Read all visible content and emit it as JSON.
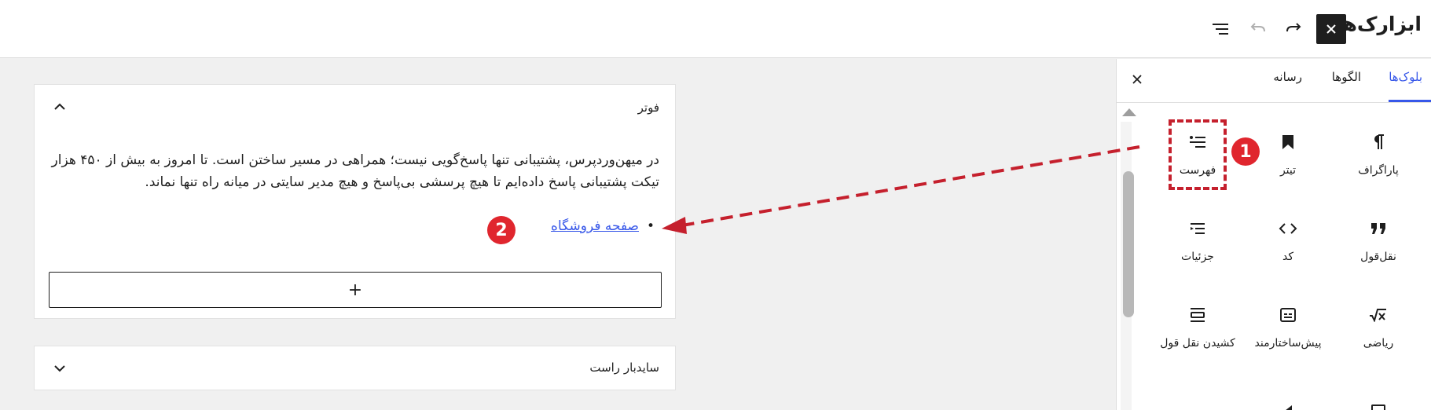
{
  "header": {
    "title": "ابزارک‌ها",
    "icons": [
      "close-icon",
      "redo-icon",
      "undo-icon",
      "list-view-icon"
    ]
  },
  "inserter": {
    "tabs": [
      {
        "label": "بلوک‌ها",
        "active": true
      },
      {
        "label": "الگوها",
        "active": false
      },
      {
        "label": "رسانه",
        "active": false
      }
    ],
    "blocks": [
      {
        "label": "پاراگراف",
        "icon": "paragraph-icon"
      },
      {
        "label": "تیتر",
        "icon": "heading-icon"
      },
      {
        "label": "فهرست",
        "icon": "list-icon"
      },
      {
        "label": "نقل‌قول",
        "icon": "quote-icon"
      },
      {
        "label": "کد",
        "icon": "code-icon"
      },
      {
        "label": "جزئیات",
        "icon": "details-icon"
      },
      {
        "label": "ریاضی",
        "icon": "math-icon"
      },
      {
        "label": "پیش‌ساختارمند",
        "icon": "preformatted-icon"
      },
      {
        "label": "کشیدن نقل قول",
        "icon": "pullquote-icon"
      }
    ]
  },
  "editor": {
    "footer_area": {
      "title": "فوتر",
      "paragraph": "در میهن‌وردپرس، پشتیبانی تنها پاسخ‌گویی نیست؛ همراهی در مسیر ساختن است. تا امروز به بیش از ۴۵۰ هزار تیکت پشتیبانی پاسخ داده‌ایم تا هیچ پرسشی بی‌پاسخ و هیچ مدیر سایتی در میانه راه تنها نماند.",
      "list_items": [
        "صفحه فروشگاه"
      ],
      "add_symbol": "+"
    },
    "sidebar_area": {
      "title": "سایدبار راست"
    }
  },
  "annotations": {
    "badge1": "1",
    "badge2": "2",
    "color": "#c5202d"
  }
}
